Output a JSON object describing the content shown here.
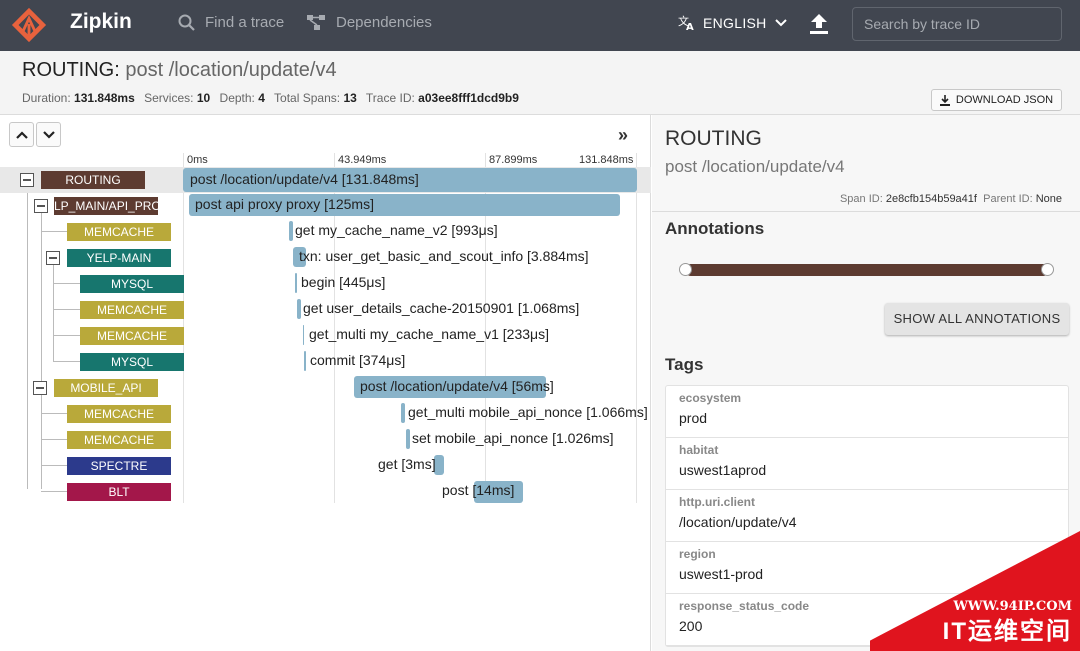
{
  "header": {
    "brand": "Zipkin",
    "nav": {
      "find_trace": "Find a trace",
      "dependencies": "Dependencies"
    },
    "language": "ENGLISH",
    "search_placeholder": "Search by trace ID"
  },
  "trace": {
    "service": "ROUTING:",
    "name": " post /location/update/v4",
    "duration_label": "Duration:",
    "duration": "131.848ms",
    "services_label": "Services:",
    "services": "10",
    "depth_label": "Depth:",
    "depth": "4",
    "spans_label": "Total Spans:",
    "spans": "13",
    "traceid_label": "Trace ID:",
    "trace_id": "a03ee8fff1dcd9b9",
    "download_label": "DOWNLOAD JSON"
  },
  "timeline": {
    "ticks": [
      "0ms",
      "43.949ms",
      "87.899ms",
      "131.848ms"
    ],
    "expand_glyph": "»"
  },
  "spans": [
    {
      "service": "ROUTING",
      "color": "#5d3b31",
      "label": "post /location/update/v4 [131.848ms]"
    },
    {
      "service": "LP_MAIN/API_PRO",
      "color": "#5d3b31",
      "label": "post api proxy proxy [125ms]"
    },
    {
      "service": "MEMCACHE",
      "color": "#b9a93a",
      "label": "get my_cache_name_v2 [993μs]"
    },
    {
      "service": "YELP-MAIN",
      "color": "#17766e",
      "label": "txn: user_get_basic_and_scout_info [3.884ms]"
    },
    {
      "service": "MYSQL",
      "color": "#17766e",
      "label": "begin [445μs]"
    },
    {
      "service": "MEMCACHE",
      "color": "#b9a93a",
      "label": "get user_details_cache-20150901 [1.068ms]"
    },
    {
      "service": "MEMCACHE",
      "color": "#b9a93a",
      "label": "get_multi my_cache_name_v1 [233μs]"
    },
    {
      "service": "MYSQL",
      "color": "#17766e",
      "label": "commit [374μs]"
    },
    {
      "service": "MOBILE_API",
      "color": "#b9a93a",
      "label": "post /location/update/v4 [56ms]"
    },
    {
      "service": "MEMCACHE",
      "color": "#b9a93a",
      "label": "get_multi mobile_api_nonce [1.066ms]"
    },
    {
      "service": "MEMCACHE",
      "color": "#b9a93a",
      "label": "set mobile_api_nonce [1.026ms]"
    },
    {
      "service": "SPECTRE",
      "color": "#2c3a8c",
      "label": "get [3ms]"
    },
    {
      "service": "BLT",
      "color": "#a3174a",
      "label": "post [14ms]"
    }
  ],
  "detail": {
    "service": "ROUTING",
    "name": "post /location/update/v4",
    "span_id_label": "Span ID:",
    "span_id": "2e8cfb154b59a41f",
    "parent_id_label": "Parent ID:",
    "parent_id": "None",
    "annotations_title": "Annotations",
    "show_all": "SHOW ALL ANNOTATIONS",
    "tags_title": "Tags",
    "tags": [
      {
        "key": "ecosystem",
        "value": "prod"
      },
      {
        "key": "habitat",
        "value": "uswest1aprod"
      },
      {
        "key": "http.uri.client",
        "value": "/location/update/v4"
      },
      {
        "key": "region",
        "value": "uswest1-prod"
      },
      {
        "key": "response_status_code",
        "value": "200"
      }
    ]
  },
  "watermark": {
    "url": "WWW.94IP.COM",
    "text": "IT运维空间"
  }
}
